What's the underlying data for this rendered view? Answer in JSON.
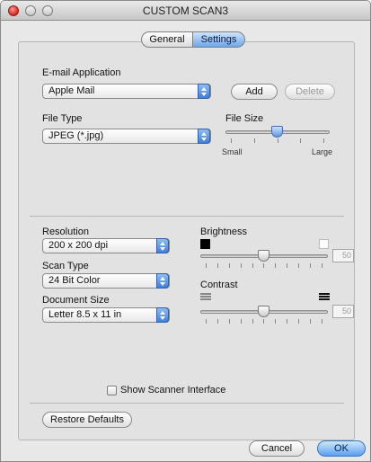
{
  "window": {
    "title": "CUSTOM SCAN3"
  },
  "tabs": [
    {
      "label": "General",
      "selected": false
    },
    {
      "label": "Settings",
      "selected": true
    }
  ],
  "email": {
    "label": "E-mail Application",
    "value": "Apple Mail",
    "add_label": "Add",
    "delete_label": "Delete"
  },
  "file_type": {
    "label": "File Type",
    "value": "JPEG (*.jpg)"
  },
  "file_size": {
    "label": "File Size",
    "min_label": "Small",
    "max_label": "Large",
    "level": 0.5
  },
  "resolution": {
    "label": "Resolution",
    "value": "200 x 200 dpi"
  },
  "scan_type": {
    "label": "Scan Type",
    "value": "24 Bit Color"
  },
  "document_size": {
    "label": "Document Size",
    "value": "Letter  8.5 x 11 in"
  },
  "brightness": {
    "label": "Brightness",
    "value": "50",
    "level": 0.5
  },
  "contrast": {
    "label": "Contrast",
    "value": "50",
    "level": 0.5
  },
  "scanner_interface": {
    "label": "Show Scanner Interface",
    "checked": false
  },
  "footer": {
    "restore_label": "Restore Defaults",
    "cancel_label": "Cancel",
    "ok_label": "OK"
  },
  "colors": {
    "accent": "#5aa0ef",
    "close": "#d1281a"
  }
}
